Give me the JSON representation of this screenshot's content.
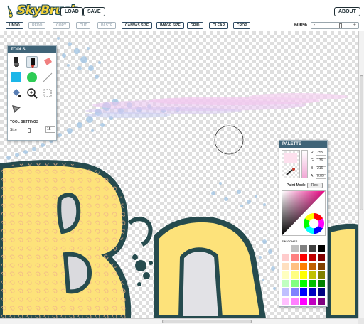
{
  "app": {
    "logo_text": "SkyBrush"
  },
  "header": {
    "load_label": "LOAD",
    "save_label": "SAVE",
    "about_label": "ABOUT"
  },
  "toolbar": {
    "undo": "UNDO",
    "redo": "REDO",
    "copy": "COPY",
    "cut": "CUT",
    "paste": "PASTE",
    "canvas_size": "CANVAS SIZE",
    "image_size": "IMAGE SIZE",
    "grid": "GRID",
    "clear": "CLEAR",
    "crop": "CROP"
  },
  "zoom": {
    "label": "600%",
    "minus": "-",
    "plus": "+",
    "level_fraction": 0.6
  },
  "tools_panel": {
    "title": "TOOLS",
    "tools": [
      "brush-icon",
      "marker-icon",
      "eraser-icon",
      "rectangle-icon",
      "ellipse-icon",
      "line-icon",
      "fill-bucket-icon",
      "zoom-icon",
      "select-icon",
      "spray-icon"
    ],
    "settings_label": "TOOL SETTINGS",
    "size_label": "Size",
    "size_value": "15"
  },
  "palette_panel": {
    "title": "PALETTE",
    "channels": [
      {
        "label": "R",
        "value": "255"
      },
      {
        "label": "G",
        "value": "136"
      },
      {
        "label": "B",
        "value": "216"
      },
      {
        "label": "A",
        "value": "0.09"
      }
    ],
    "paint_mode_label": "Paint Mode",
    "paint_mode_value": "Rest",
    "swatches_label": "SWATCHES",
    "swatch_colors": [
      "#ffffff",
      "#c0c0c0",
      "#808080",
      "#404040",
      "#000000",
      "#ffcccc",
      "#ff8080",
      "#ff0000",
      "#c00000",
      "#800000",
      "#ffe0c0",
      "#ffc080",
      "#ff8000",
      "#c06000",
      "#804000",
      "#ffffc0",
      "#ffff80",
      "#ffff00",
      "#c0c000",
      "#808000",
      "#c0ffc0",
      "#80ff80",
      "#00ff00",
      "#00c000",
      "#008000",
      "#c0c0ff",
      "#8080ff",
      "#0000ff",
      "#0000c0",
      "#000080",
      "#ffc0ff",
      "#ff80ff",
      "#ff00ff",
      "#c000c0",
      "#800080"
    ]
  },
  "colors": {
    "panel_title_bg": "#3f6478",
    "art_yellow": "#fde27a",
    "art_outline": "#264b4e"
  }
}
